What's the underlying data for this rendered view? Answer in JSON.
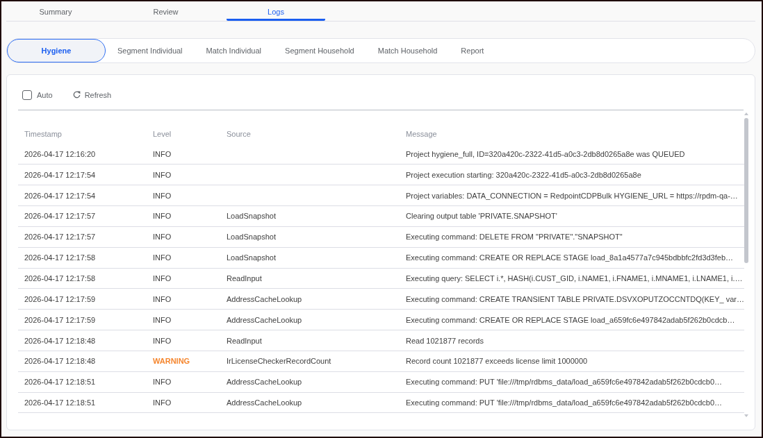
{
  "tabs": [
    {
      "label": "Summary",
      "selected": false
    },
    {
      "label": "Review",
      "selected": false
    },
    {
      "label": "Logs",
      "selected": true
    }
  ],
  "subtabs": [
    {
      "label": "Hygiene",
      "selected": true
    },
    {
      "label": "Segment Individual",
      "selected": false
    },
    {
      "label": "Match Individual",
      "selected": false
    },
    {
      "label": "Segment Household",
      "selected": false
    },
    {
      "label": "Match Household",
      "selected": false
    },
    {
      "label": "Report",
      "selected": false
    }
  ],
  "toolbar": {
    "auto": {
      "label": "Auto",
      "checked": false
    },
    "refresh": {
      "label": "Refresh"
    }
  },
  "table": {
    "columns": [
      "Timestamp",
      "Level",
      "Source",
      "Message"
    ],
    "rows": [
      {
        "kind": "info",
        "timestamp": "2026-04-17 12:16:20",
        "level": "INFO",
        "message": "Project hygiene_full, ID=320a420c-2322-41d5-a0c3-2db8d0265a8e was QUEUED"
      },
      {
        "kind": "info",
        "timestamp": "2026-04-17 12:17:54",
        "level": "INFO",
        "message": "Project execution starting: 320a420c-2322-41d5-a0c3-2db8d0265a8e"
      },
      {
        "kind": "info",
        "timestamp": "2026-04-17 12:17:54",
        "level": "INFO",
        "message": "Project variables: DATA_CONNECTION = RedpointCDPBulk HYGIENE_URL = https://rpdm-qa-…"
      },
      {
        "kind": "info",
        "timestamp": "2026-04-17 12:17:57",
        "level": "INFO",
        "source": "LoadSnapshot",
        "message": "Clearing output table 'PRIVATE.SNAPSHOT'"
      },
      {
        "kind": "info",
        "timestamp": "2026-04-17 12:17:57",
        "level": "INFO",
        "source": "LoadSnapshot",
        "message": "Executing command: DELETE FROM \"PRIVATE\".\"SNAPSHOT\""
      },
      {
        "kind": "info",
        "timestamp": "2026-04-17 12:17:58",
        "level": "INFO",
        "source": "LoadSnapshot",
        "message": "Executing command: CREATE OR REPLACE STAGE load_8a1a4577a7c945bdbbfc2fd3d3feb…"
      },
      {
        "kind": "info",
        "timestamp": "2026-04-17 12:17:58",
        "level": "INFO",
        "source": "ReadInput",
        "message": "Executing query: SELECT i.*, HASH(i.CUST_GID, i.NAME1, i.FNAME1, i.MNAME1, i.LNAME1, i.…"
      },
      {
        "kind": "info",
        "timestamp": "2026-04-17 12:17:59",
        "level": "INFO",
        "source": "AddressCacheLookup",
        "message": "Executing command: CREATE TRANSIENT TABLE PRIVATE.DSVXOPUTZOCCNTDQ(KEY_ var…"
      },
      {
        "kind": "info",
        "timestamp": "2026-04-17 12:17:59",
        "level": "INFO",
        "source": "AddressCacheLookup",
        "message": "Executing command: CREATE OR REPLACE STAGE load_a659fc6e497842adab5f262b0cdcb…"
      },
      {
        "kind": "info",
        "timestamp": "2026-04-17 12:18:48",
        "level": "INFO",
        "source": "ReadInput",
        "message": "Read 1021877 records"
      },
      {
        "kind": "warning",
        "timestamp": "2026-04-17 12:18:48",
        "level": "WARNING",
        "source": "IrLicenseCheckerRecordCount",
        "message": "Record count 1021877 exceeds license limit 1000000"
      },
      {
        "kind": "info",
        "timestamp": "2026-04-17 12:18:51",
        "level": "INFO",
        "source": "AddressCacheLookup",
        "message": "Executing command: PUT 'file:///tmp/rdbms_data/load_a659fc6e497842adab5f262b0cdcb0…"
      },
      {
        "kind": "info",
        "timestamp": "2026-04-17 12:18:51",
        "level": "INFO",
        "source": "AddressCacheLookup",
        "message": "Executing command: PUT 'file:///tmp/rdbms_data/load_a659fc6e497842adab5f262b0cdcb0…"
      }
    ]
  }
}
